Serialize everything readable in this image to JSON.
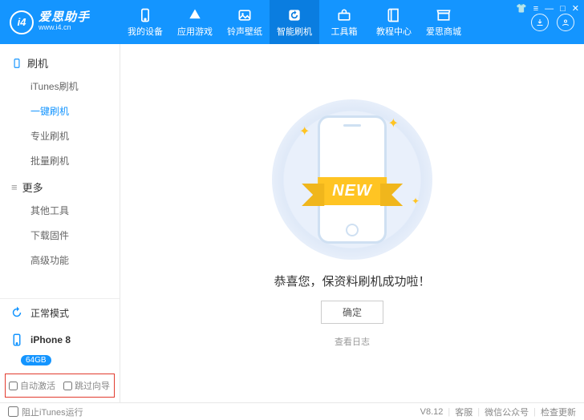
{
  "brand": {
    "name": "爱思助手",
    "url": "www.i4.cn",
    "logo_text": "i4"
  },
  "nav": [
    {
      "label": "我的设备"
    },
    {
      "label": "应用游戏"
    },
    {
      "label": "铃声壁纸"
    },
    {
      "label": "智能刷机"
    },
    {
      "label": "工具箱"
    },
    {
      "label": "教程中心"
    },
    {
      "label": "爱思商城"
    }
  ],
  "sidebar": {
    "group1": {
      "title": "刷机",
      "items": [
        "iTunes刷机",
        "一键刷机",
        "专业刷机",
        "批量刷机"
      ]
    },
    "group2": {
      "title": "更多",
      "items": [
        "其他工具",
        "下载固件",
        "高级功能"
      ]
    },
    "mode": "正常模式",
    "device": {
      "name": "iPhone 8",
      "storage": "64GB"
    },
    "options": {
      "auto_activate": "自动激活",
      "skip_guide": "跳过向导"
    }
  },
  "main": {
    "ribbon": "NEW",
    "message": "恭喜您，保资料刷机成功啦！",
    "ok": "确定",
    "view_log": "查看日志"
  },
  "footer": {
    "block_itunes": "阻止iTunes运行",
    "version": "V8.12",
    "support": "客服",
    "wechat": "微信公众号",
    "update": "检查更新"
  }
}
